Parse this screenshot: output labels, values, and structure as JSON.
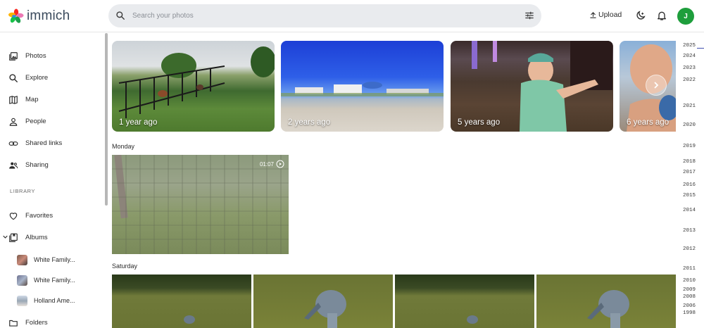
{
  "header": {
    "logo_text": "immich",
    "search_placeholder": "Search your photos",
    "upload_label": "Upload",
    "avatar_initial": "J"
  },
  "sidebar": {
    "nav": [
      {
        "label": "Photos",
        "icon": "photos-icon"
      },
      {
        "label": "Explore",
        "icon": "search-icon"
      },
      {
        "label": "Map",
        "icon": "map-icon"
      },
      {
        "label": "People",
        "icon": "person-icon"
      },
      {
        "label": "Shared links",
        "icon": "link-icon"
      },
      {
        "label": "Sharing",
        "icon": "sharing-icon"
      }
    ],
    "library_label": "LIBRARY",
    "favorites_label": "Favorites",
    "albums_label": "Albums",
    "albums": [
      {
        "label": "White Family..."
      },
      {
        "label": "White Family..."
      },
      {
        "label": "Holland Ame..."
      }
    ],
    "folders_label": "Folders"
  },
  "memories": [
    {
      "label": "1 year ago"
    },
    {
      "label": "2 years ago"
    },
    {
      "label": "5 years ago"
    },
    {
      "label": "6 years ago"
    }
  ],
  "sections": [
    {
      "label": "Monday",
      "video_duration": "01:07"
    },
    {
      "label": "Saturday"
    }
  ],
  "timeline_years": [
    "2025",
    "2024",
    "2023",
    "2022",
    "2021",
    "2020",
    "2019",
    "2018",
    "2017",
    "2016",
    "2015",
    "2014",
    "2013",
    "2012",
    "2011",
    "2010",
    "2009",
    "2008",
    "2006",
    "1998"
  ],
  "colors": {
    "accent": "#4250af",
    "avatar_bg": "#1e9e3c",
    "search_bg": "#e9ebee"
  }
}
